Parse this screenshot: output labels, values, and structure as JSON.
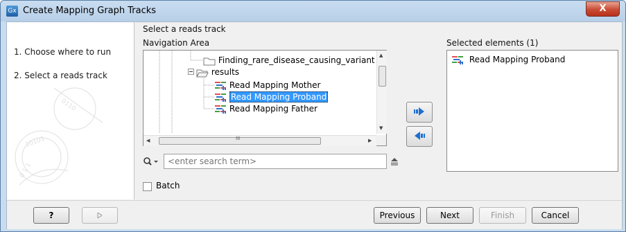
{
  "window": {
    "title": "Create Mapping Graph Tracks",
    "app_icon_text": "Gx",
    "close_glyph": "X"
  },
  "steps": [
    {
      "label": "1.  Choose where to run"
    },
    {
      "label": "2.  Select a reads track"
    }
  ],
  "main": {
    "heading": "Select a reads track",
    "navigation_label": "Navigation Area",
    "selected_label": "Selected elements (1)",
    "tree": [
      {
        "label": "Finding_rare_disease_causing_variant",
        "icon": "folder-icon"
      },
      {
        "label": "results",
        "icon": "folder-open-icon"
      },
      {
        "label": "Read Mapping Mother",
        "icon": "read-mapping-icon"
      },
      {
        "label": "Read Mapping Proband",
        "icon": "read-mapping-icon",
        "selected": true
      },
      {
        "label": "Read Mapping Father",
        "icon": "read-mapping-icon"
      }
    ],
    "search_placeholder": "<enter search term>",
    "batch_label": "Batch",
    "selected_items": [
      {
        "label": "Read Mapping Proband",
        "icon": "read-mapping-icon"
      }
    ],
    "hscroll_grip": "III"
  },
  "footer": {
    "help_label": "?",
    "previous_label": "Previous",
    "next_label": "Next",
    "finish_label": "Finish",
    "cancel_label": "Cancel"
  },
  "colors": {
    "selection": "#3399ff",
    "arrow_blue": "#1e6fd0",
    "close_red": "#c94b34"
  }
}
